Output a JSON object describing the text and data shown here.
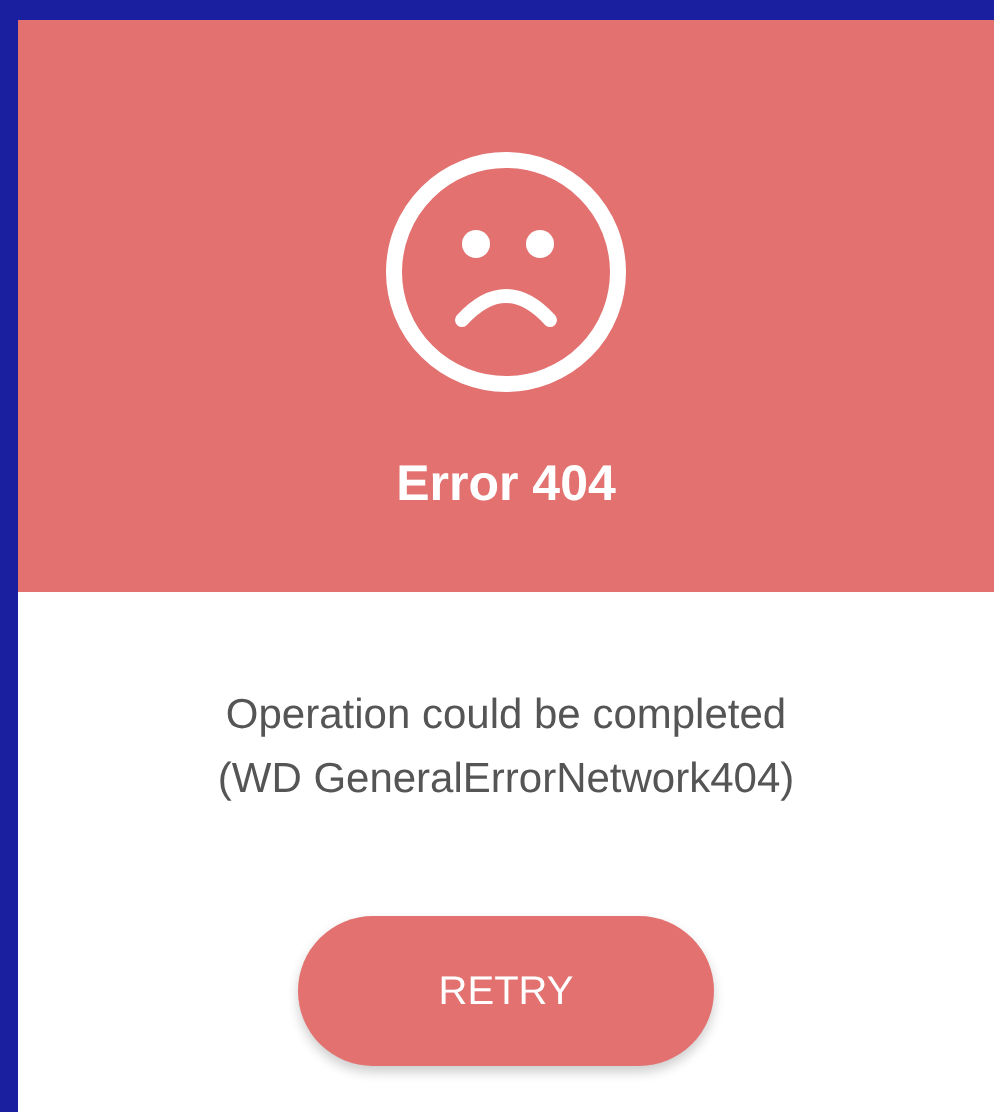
{
  "dialog": {
    "title": "Error 404",
    "message_lines": [
      "Operation could be completed",
      "(WD GeneralErrorNetwork404)"
    ],
    "button": "RETRY"
  }
}
